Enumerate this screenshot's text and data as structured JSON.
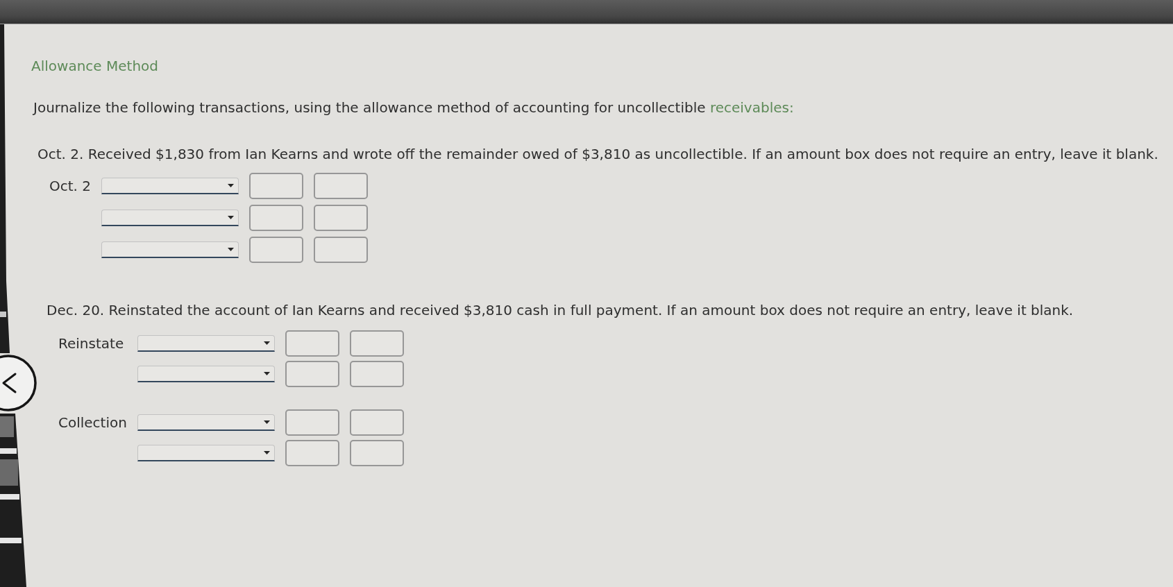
{
  "heading": "Allowance Method",
  "instructions": {
    "text": "Journalize the following transactions, using the allowance method of accounting for uncollectible ",
    "link": "receivables:"
  },
  "transactions": [
    {
      "description": "Oct. 2. Received $1,830 from Ian Kearns and wrote off the remainder owed of $3,810 as uncollectible. If an amount box does not require an entry, leave it blank.",
      "entries": [
        {
          "label": "Oct. 2",
          "lines": [
            {
              "kind": "journal_line"
            },
            {
              "kind": "journal_line"
            },
            {
              "kind": "journal_line"
            }
          ]
        }
      ]
    },
    {
      "description": "Dec. 20. Reinstated the account of Ian Kearns and received $3,810 cash in full payment. If an amount box does not require an entry, leave it blank.",
      "entries": [
        {
          "label": "Reinstate",
          "lines": [
            {
              "kind": "journal_line"
            },
            {
              "kind": "journal_line"
            }
          ]
        },
        {
          "label": "Collection",
          "lines": [
            {
              "kind": "journal_line"
            },
            {
              "kind": "journal_line"
            }
          ]
        }
      ]
    }
  ]
}
